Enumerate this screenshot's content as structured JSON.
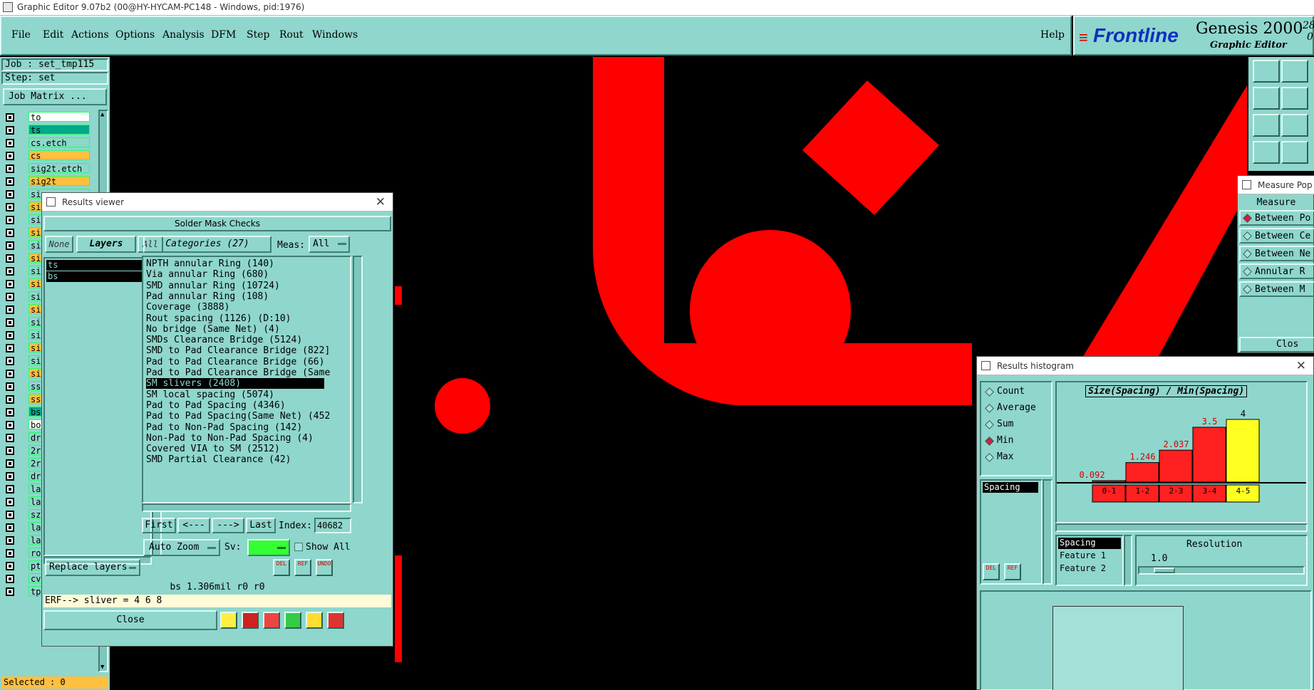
{
  "window": {
    "title": "Graphic Editor 9.07b2 (00@HY-HYCAM-PC148 - Windows, pid:1976)"
  },
  "menu": {
    "items": [
      "File",
      "Edit",
      "Actions",
      "Options",
      "Analysis",
      "DFM",
      "Step",
      "Rout",
      "Windows"
    ],
    "help": "Help"
  },
  "brand": {
    "logo": "Frontline",
    "product": "Genesis 2000",
    "subtitle": "Graphic Editor",
    "date_top": "28",
    "date_bottom": "0"
  },
  "job": {
    "job": "Job : set_tmp115",
    "step": "Step: set",
    "matrix": "Job Matrix ..."
  },
  "layers": [
    {
      "name": "to",
      "color": "#ffffff"
    },
    {
      "name": "ts",
      "color": "#00aa88"
    },
    {
      "name": "cs.etch",
      "color": "#8fd6cc"
    },
    {
      "name": "cs",
      "color": "#ffc040"
    },
    {
      "name": "sig2t.etch",
      "color": "#8fd6cc"
    },
    {
      "name": "sig2t",
      "color": "#ffc040"
    },
    {
      "name": "si",
      "color": "#8fd6cc"
    },
    {
      "name": "si",
      "color": "#ffc040"
    },
    {
      "name": "si",
      "color": "#8fd6cc"
    },
    {
      "name": "si",
      "color": "#ffc040"
    },
    {
      "name": "si",
      "color": "#8fd6cc"
    },
    {
      "name": "si",
      "color": "#ffc040"
    },
    {
      "name": "si",
      "color": "#8fd6cc"
    },
    {
      "name": "si",
      "color": "#ffc040"
    },
    {
      "name": "si",
      "color": "#8fd6cc"
    },
    {
      "name": "si",
      "color": "#ffc040"
    },
    {
      "name": "si",
      "color": "#8fd6cc"
    },
    {
      "name": "si",
      "color": "#8fd6cc"
    },
    {
      "name": "si",
      "color": "#ffc040"
    },
    {
      "name": "si",
      "color": "#8fd6cc"
    },
    {
      "name": "si",
      "color": "#ffc040"
    },
    {
      "name": "ss",
      "color": "#8fd6cc"
    },
    {
      "name": "ss",
      "color": "#ffc040"
    },
    {
      "name": "bs",
      "color": "#00aa88"
    },
    {
      "name": "bo",
      "color": "#ffffff"
    },
    {
      "name": "dr",
      "color": "#8fd6cc"
    },
    {
      "name": "2r",
      "color": "#8fd6cc"
    },
    {
      "name": "2r",
      "color": "#8fd6cc"
    },
    {
      "name": "dr",
      "color": "#8fd6cc"
    },
    {
      "name": "la",
      "color": "#8fd6cc"
    },
    {
      "name": "la",
      "color": "#8fd6cc"
    },
    {
      "name": "sz",
      "color": "#8fd6cc"
    },
    {
      "name": "la",
      "color": "#8fd6cc"
    },
    {
      "name": "la",
      "color": "#8fd6cc"
    },
    {
      "name": "ro",
      "color": "#8fd6cc"
    },
    {
      "name": "pthrou",
      "color": "#8fd6cc"
    },
    {
      "name": "cvia",
      "color": "#8fd6cc"
    },
    {
      "name": "tp",
      "color": "#8fd6cc"
    }
  ],
  "selected": "Selected : 0",
  "results_viewer": {
    "title": "Results viewer",
    "header": "Solder Mask Checks",
    "none": "None",
    "layers": "Layers",
    "all": "All",
    "categories_btn": "Categories (27)",
    "meas_label": "Meas:",
    "meas_value": "All",
    "layer_list": [
      "ts",
      "bs"
    ],
    "categories": [
      "NPTH annular Ring (140)",
      "Via annular Ring (680)",
      "SMD annular Ring (10724)",
      "Pad annular Ring (108)",
      "Coverage (3888)",
      "Rout spacing (1126)       (D:10)",
      "No bridge (Same Net) (4)",
      "SMDs Clearance Bridge (5124)",
      "SMD to Pad Clearance Bridge (822]",
      "Pad to Pad Clearance Bridge (66)",
      "Pad to Pad Clearance Bridge (Same",
      "SM slivers (2408)",
      "SM local spacing (5074)",
      "Pad to Pad Spacing (4346)",
      "Pad to Pad Spacing(Same Net) (452",
      "Pad to Non-Pad Spacing (142)",
      "Non-Pad to Non-Pad Spacing (4)",
      "Covered VIA to SM (2512)",
      "SMD Partial Clearance (42)"
    ],
    "selected_index": 11,
    "nav": {
      "first": "First",
      "prev": "<---",
      "next": "--->",
      "last": "Last",
      "index_label": "Index:",
      "index_value": "40682"
    },
    "auto_zoom": "Auto Zoom",
    "sv_label": "Sv:",
    "show_all": "Show All",
    "replace_layers": "Replace layers",
    "status": "bs 1.306mil  r0  r0",
    "erf": "ERF--> sliver = 4 6 8",
    "close": "Close",
    "icons": {
      "del": "DEL",
      "ref": "REF",
      "undo": "UNDO"
    }
  },
  "measure_popup": {
    "title": "Measure Pop",
    "header": "Measure",
    "items": [
      "Between Po",
      "Between Ce",
      "Between Ne",
      "Annular R",
      "Between M"
    ],
    "selected": 0,
    "close": "Clos"
  },
  "histogram": {
    "title": "Results histogram",
    "modes": [
      "Count",
      "Average",
      "Sum",
      "Min",
      "Max"
    ],
    "selected_mode": 3,
    "chart_title": "Size(Spacing) / Min(Spacing)",
    "list_item": "Spacing",
    "icons": {
      "del": "DEL",
      "ref": "REF"
    },
    "info_lines": [
      "Spacing",
      "Feature 1",
      "Feature 2"
    ],
    "resolution_label": "Resolution",
    "resolution_value": "1.0"
  },
  "chart_data": {
    "type": "bar",
    "title": "Size(Spacing) / Min(Spacing)",
    "categories": [
      "0-1",
      "1-2",
      "2-3",
      "3-4",
      "4-5"
    ],
    "values": [
      0.092,
      1.246,
      2.037,
      3.5,
      4
    ],
    "value_labels": [
      "0.092",
      "1.246",
      "2.037",
      "3.5",
      "4"
    ],
    "colors": [
      "#ff2020",
      "#ff2020",
      "#ff2020",
      "#ff2020",
      "#ffff20"
    ],
    "ylim": [
      0,
      4
    ]
  },
  "colors": {
    "panel": "#8fd6cc",
    "feature": "#ff0000",
    "canvas": "#000000"
  }
}
